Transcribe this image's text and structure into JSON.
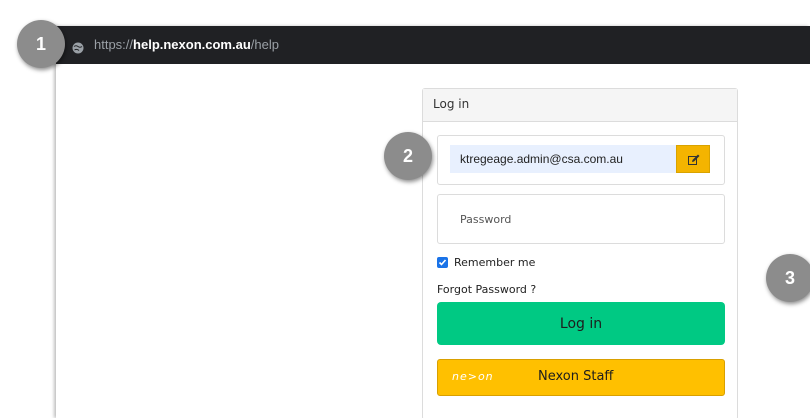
{
  "browser": {
    "url_scheme": "https://",
    "url_host": "help.nexon.com.au",
    "url_path": "/help",
    "icon": "globe-icon"
  },
  "login_panel": {
    "title": "Log in",
    "email_value": "ktregeage.admin@csa.com.au",
    "edit_icon": "edit-icon",
    "password_placeholder": "Password",
    "remember_label": "Remember me",
    "remember_checked": true,
    "forgot_label": "Forgot Password ?",
    "login_label": "Log in",
    "staff_logo_text": "ne>on",
    "staff_label": "Nexon Staff"
  },
  "callouts": [
    "1",
    "2",
    "3"
  ],
  "colors": {
    "address_bar": "#202124",
    "login_button": "#00c983",
    "staff_button": "#ffc000",
    "edit_button": "#f4b400",
    "email_autofill": "#e8f0fe",
    "callout": "#8c8c8c"
  }
}
